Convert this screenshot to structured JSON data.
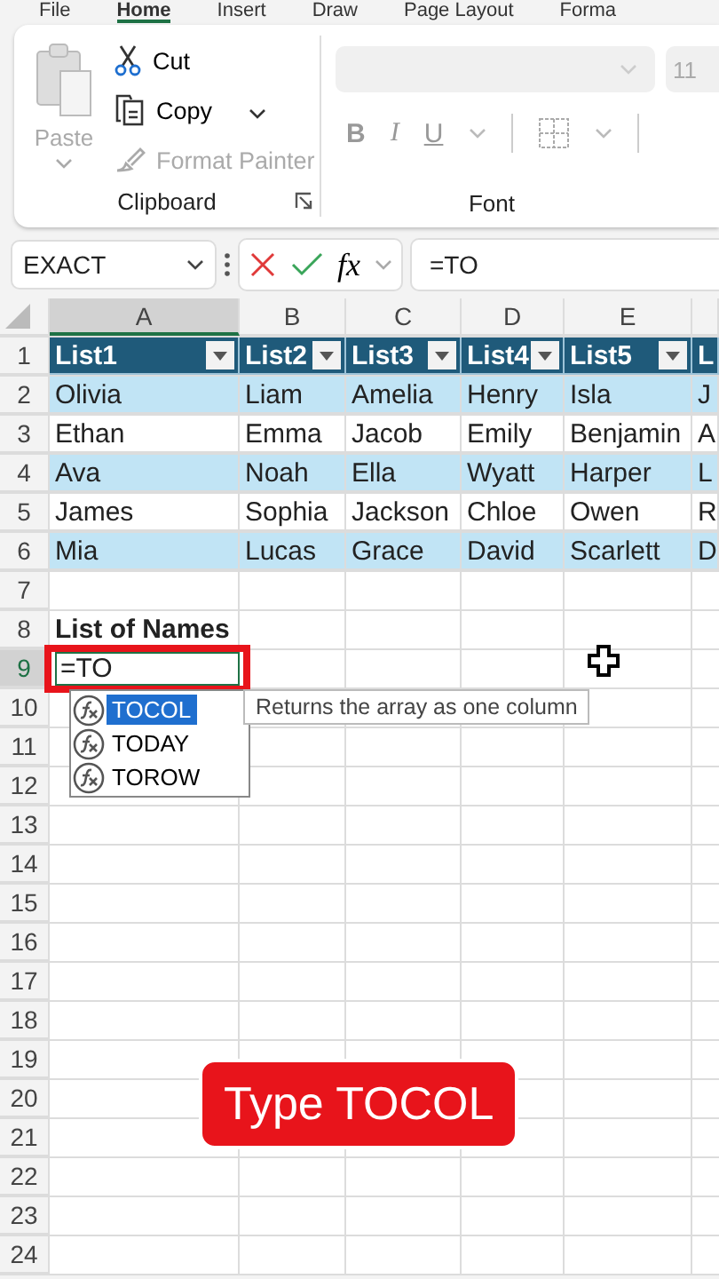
{
  "ribbon_tabs": [
    {
      "label": "File",
      "selected": false
    },
    {
      "label": "Home",
      "selected": true
    },
    {
      "label": "Insert",
      "selected": false
    },
    {
      "label": "Draw",
      "selected": false
    },
    {
      "label": "Page Layout",
      "selected": false
    },
    {
      "label": "Forma",
      "selected": false
    }
  ],
  "clipboard": {
    "paste": {
      "label": "Paste",
      "disabled": true
    },
    "buttons": [
      {
        "kind": "cut",
        "label": "Cut",
        "disabled": false
      },
      {
        "kind": "copy",
        "label": "Copy",
        "disabled": false
      },
      {
        "kind": "painter",
        "label": "Format Painter",
        "disabled": true
      }
    ],
    "group_label": "Clipboard"
  },
  "font": {
    "disabled": true,
    "size": "11",
    "bold": "B",
    "italic": "I",
    "underline": "U",
    "group_label": "Font"
  },
  "formula_bar": {
    "name_box": "EXACT",
    "fx": "fx",
    "formula": "=TO"
  },
  "columns": [
    {
      "label": "A",
      "selected": true
    },
    {
      "label": "B",
      "selected": false
    },
    {
      "label": "C",
      "selected": false
    },
    {
      "label": "D",
      "selected": false
    },
    {
      "label": "E",
      "selected": false
    }
  ],
  "row_numbers": [
    {
      "label": "1",
      "selected": false
    },
    {
      "label": "2",
      "selected": false
    },
    {
      "label": "3",
      "selected": false
    },
    {
      "label": "4",
      "selected": false
    },
    {
      "label": "5",
      "selected": false
    },
    {
      "label": "6",
      "selected": false
    },
    {
      "label": "7",
      "selected": false
    },
    {
      "label": "8",
      "selected": false
    },
    {
      "label": "9",
      "selected": true
    },
    {
      "label": "10",
      "selected": false
    },
    {
      "label": "11",
      "selected": false
    },
    {
      "label": "12",
      "selected": false
    },
    {
      "label": "13",
      "selected": false
    },
    {
      "label": "14",
      "selected": false
    },
    {
      "label": "15",
      "selected": false
    },
    {
      "label": "16",
      "selected": false
    },
    {
      "label": "17",
      "selected": false
    },
    {
      "label": "18",
      "selected": false
    },
    {
      "label": "19",
      "selected": false
    },
    {
      "label": "20",
      "selected": false
    },
    {
      "label": "21",
      "selected": false
    },
    {
      "label": "22",
      "selected": false
    },
    {
      "label": "23",
      "selected": false
    },
    {
      "label": "24",
      "selected": false
    }
  ],
  "table": {
    "headers": [
      "List1",
      "List2",
      "List3",
      "List4",
      "List5",
      "L"
    ],
    "rows": [
      [
        "Olivia",
        "Liam",
        "Amelia",
        "Henry",
        "Isla",
        "J"
      ],
      [
        "Ethan",
        "Emma",
        "Jacob",
        "Emily",
        "Benjamin",
        "A"
      ],
      [
        "Ava",
        "Noah",
        "Ella",
        "Wyatt",
        "Harper",
        "L"
      ],
      [
        "James",
        "Sophia",
        "Jackson",
        "Chloe",
        "Owen",
        "R"
      ],
      [
        "Mia",
        "Lucas",
        "Grace",
        "David",
        "Scarlett",
        "D"
      ]
    ]
  },
  "list_title": "List of Names",
  "editing_cell": "=TO",
  "autocomplete": [
    {
      "label": "TOCOL",
      "selected": true
    },
    {
      "label": "TODAY",
      "selected": false
    },
    {
      "label": "TOROW",
      "selected": false
    }
  ],
  "tooltip": "Returns the array as one column",
  "caption": "Type TOCOL"
}
